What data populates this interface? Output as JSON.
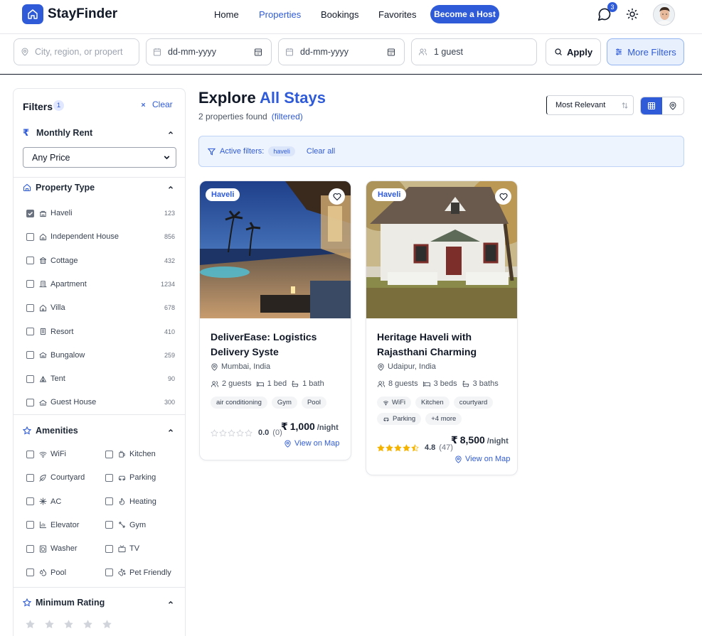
{
  "app": {
    "brand": "StayFinder"
  },
  "nav": {
    "links": [
      "Home",
      "Properties",
      "Bookings",
      "Favorites"
    ],
    "active": "Properties",
    "host_label": "Become a Host",
    "message_count": "3"
  },
  "search": {
    "location_placeholder": "City, region, or propert",
    "checkin_placeholder": "dd-mm-yyyy",
    "checkout_placeholder": "dd-mm-yyyy",
    "guests_value": "1 guest",
    "apply_label": "Apply",
    "more_filters_label": "More Filters"
  },
  "sidebar": {
    "title": "Filters",
    "active_count": "1",
    "clear_label": "Clear",
    "rent": {
      "title": "Monthly Rent",
      "currency_symbol": "₹",
      "selected": "Any Price"
    },
    "property_type": {
      "title": "Property Type",
      "items": [
        {
          "label": "Haveli",
          "count": "123",
          "checked": true,
          "icon": "haveli-icon"
        },
        {
          "label": "Independent House",
          "count": "856",
          "checked": false,
          "icon": "house-icon"
        },
        {
          "label": "Cottage",
          "count": "432",
          "checked": false,
          "icon": "cottage-icon"
        },
        {
          "label": "Apartment",
          "count": "1234",
          "checked": false,
          "icon": "apartment-icon"
        },
        {
          "label": "Villa",
          "count": "678",
          "checked": false,
          "icon": "villa-icon"
        },
        {
          "label": "Resort",
          "count": "410",
          "checked": false,
          "icon": "resort-icon"
        },
        {
          "label": "Bungalow",
          "count": "259",
          "checked": false,
          "icon": "bungalow-icon"
        },
        {
          "label": "Tent",
          "count": "90",
          "checked": false,
          "icon": "tent-icon"
        },
        {
          "label": "Guest House",
          "count": "300",
          "checked": false,
          "icon": "guest-house-icon"
        }
      ]
    },
    "amenities": {
      "title": "Amenities",
      "items": [
        {
          "label": "WiFi",
          "icon": "wifi-icon"
        },
        {
          "label": "Kitchen",
          "icon": "kitchen-icon"
        },
        {
          "label": "Courtyard",
          "icon": "leaf-icon"
        },
        {
          "label": "Parking",
          "icon": "car-icon"
        },
        {
          "label": "AC",
          "icon": "snowflake-icon"
        },
        {
          "label": "Heating",
          "icon": "flame-icon"
        },
        {
          "label": "Elevator",
          "icon": "elevator-icon"
        },
        {
          "label": "Gym",
          "icon": "dumbbell-icon"
        },
        {
          "label": "Washer",
          "icon": "washer-icon"
        },
        {
          "label": "TV",
          "icon": "tv-icon"
        },
        {
          "label": "Pool",
          "icon": "droplets-icon"
        },
        {
          "label": "Pet Friendly",
          "icon": "paw-icon"
        }
      ]
    },
    "min_rating": {
      "title": "Minimum Rating",
      "stars": 5
    }
  },
  "main": {
    "title_prefix": "Explore",
    "title_accent": "All Stays",
    "found_text": "2 properties found",
    "found_tag": "(filtered)",
    "sort_selected": "Most Relevant",
    "active_filters_label": "Active filters:",
    "active_filter_chip": "haveli",
    "clear_all_label": "Clear all"
  },
  "listings": [
    {
      "type": "Haveli",
      "title": "DeliverEase: Logistics Delivery Syste",
      "location": "Mumbai, India",
      "guests": "2 guests",
      "beds": "1 bed",
      "baths": "1 bath",
      "amenities": [
        "air conditioning",
        "Gym",
        "Pool"
      ],
      "rating": "0.0",
      "reviews": "(0)",
      "stars_filled": 0,
      "currency": "₹",
      "price": "1,000",
      "per": "/night",
      "map_label": "View on Map"
    },
    {
      "type": "Haveli",
      "title": "Heritage Haveli with Rajasthani Charming",
      "location": "Udaipur, India",
      "guests": "8 guests",
      "beds": "3 beds",
      "baths": "3 baths",
      "amenities": [
        "WiFi",
        "Kitchen",
        "courtyard",
        "Parking",
        "+4 more"
      ],
      "rating": "4.8",
      "reviews": "(47)",
      "stars_filled": 4.5,
      "currency": "₹",
      "price": "8,500",
      "per": "/night",
      "map_label": "View on Map"
    }
  ],
  "colors": {
    "accent": "#2f5bd8",
    "star": "#f5b301"
  }
}
